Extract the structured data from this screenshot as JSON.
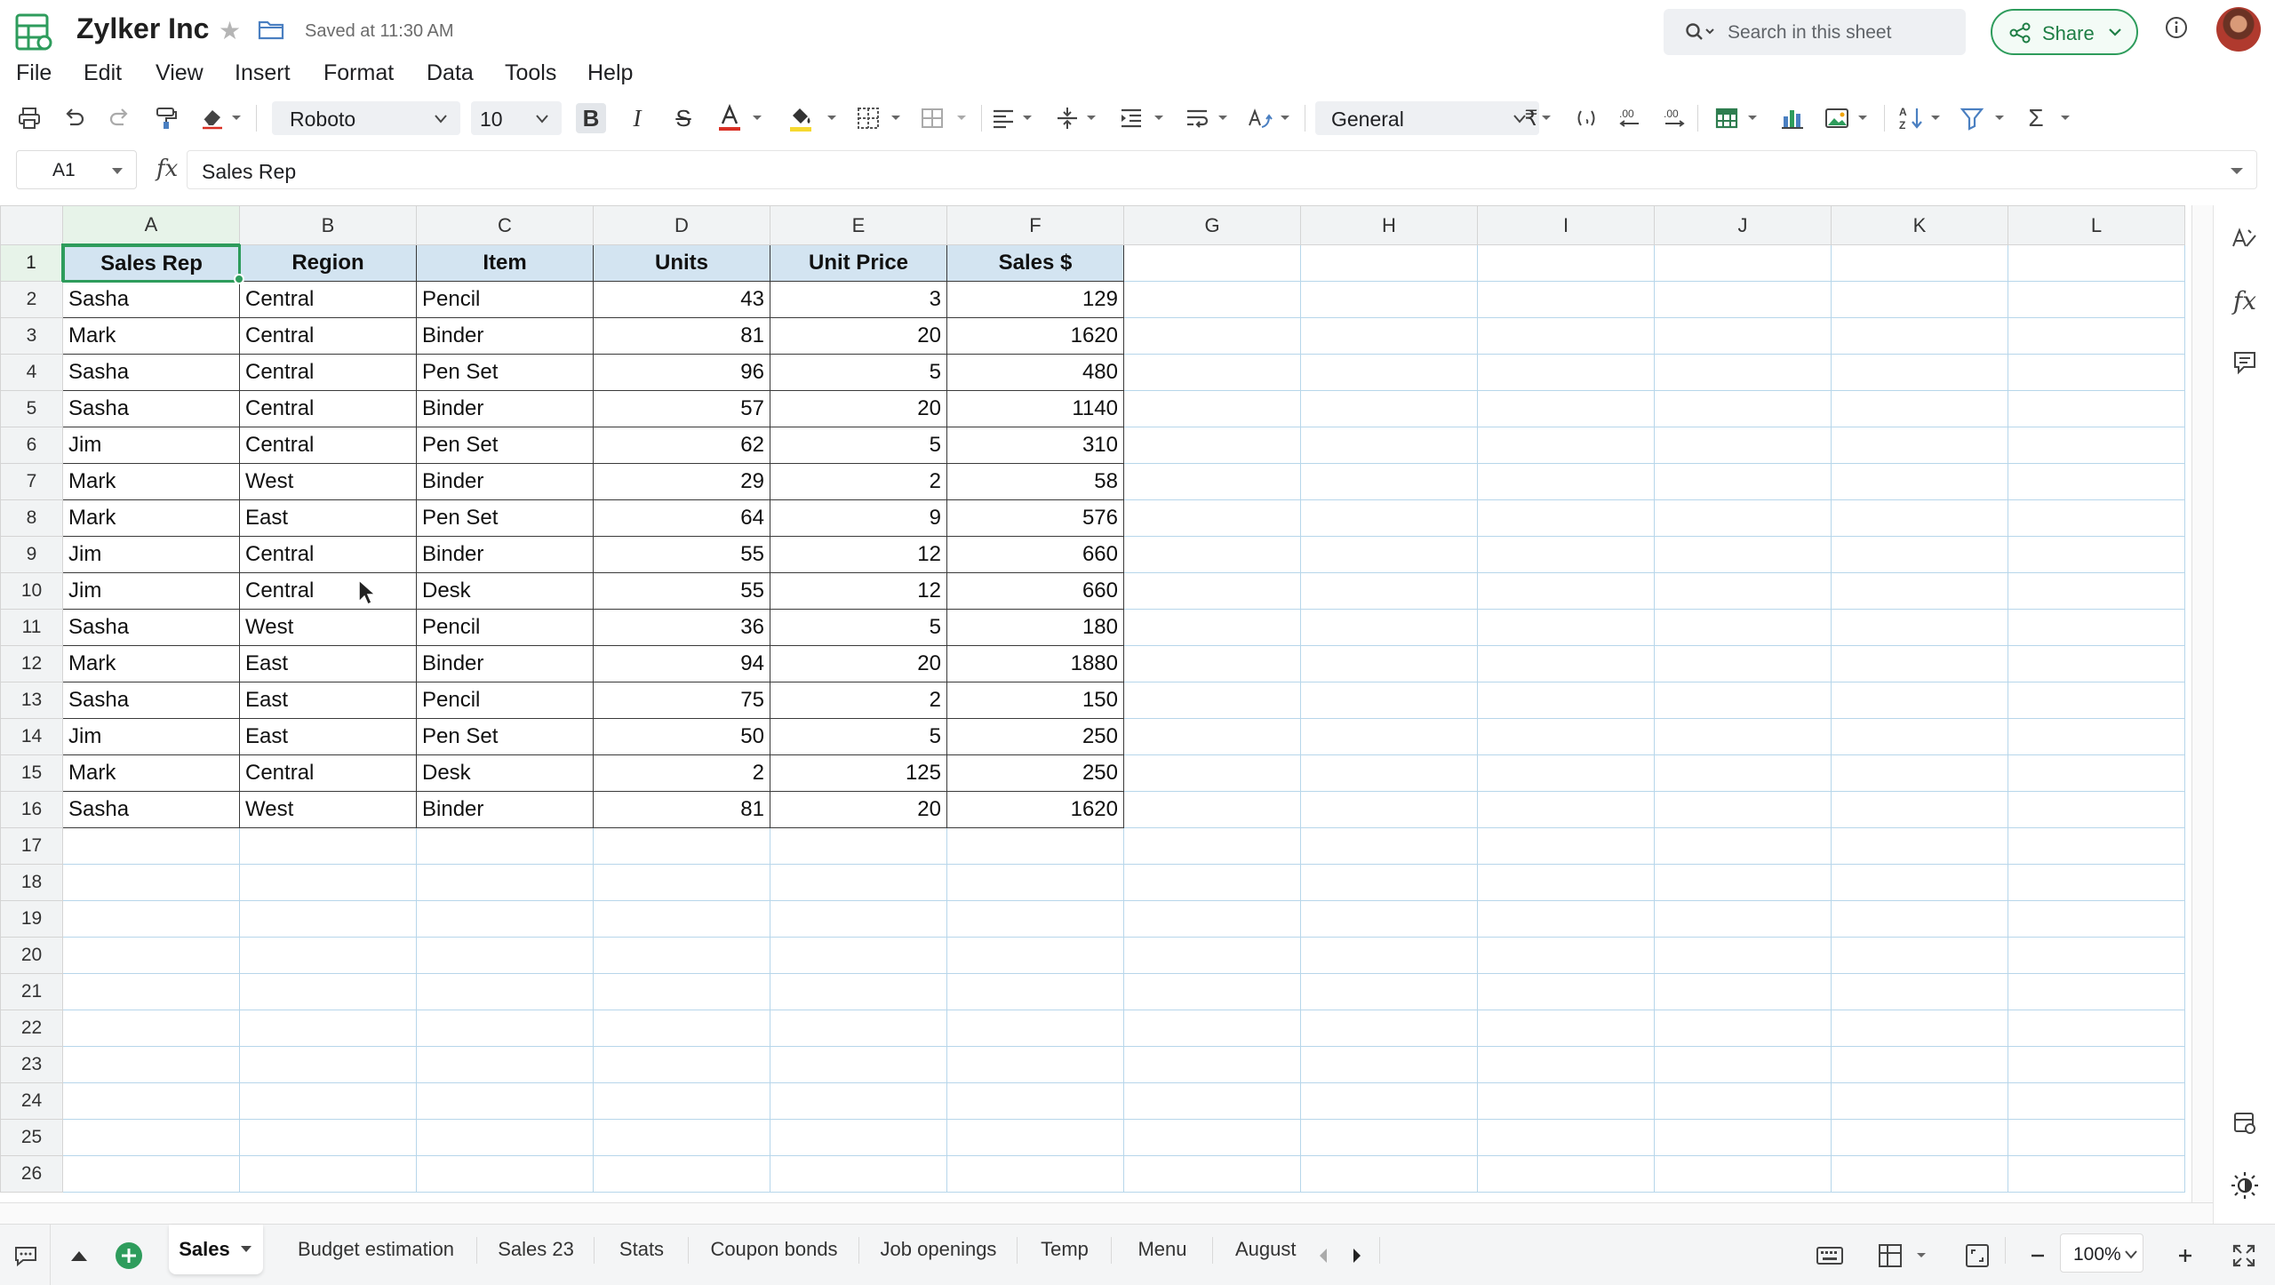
{
  "app": {
    "title": "Zylker Inc",
    "saved_status": "Saved at 11:30 AM",
    "search_placeholder": "Search in this sheet",
    "share_label": "Share"
  },
  "menu": [
    "File",
    "Edit",
    "View",
    "Insert",
    "Format",
    "Data",
    "Tools",
    "Help"
  ],
  "toolbar": {
    "font_name": "Roboto",
    "font_size": "10",
    "number_format": "General",
    "currency_symbol": "₹",
    "text_color": "#d93025",
    "fill_color": "#f6d930"
  },
  "formula_bar": {
    "cell_ref": "A1",
    "fx_label": "fx",
    "content": "Sales Rep"
  },
  "sheet": {
    "columns": [
      "A",
      "B",
      "C",
      "D",
      "E",
      "F",
      "G",
      "H",
      "I",
      "J",
      "K",
      "L"
    ],
    "row_count_visible": 26,
    "header": [
      "Sales Rep",
      "Region",
      "Item",
      "Units",
      "Unit Price",
      "Sales $"
    ],
    "rows": [
      [
        "Sasha",
        "Central",
        "Pencil",
        "43",
        "3",
        "129"
      ],
      [
        "Mark",
        "Central",
        "Binder",
        "81",
        "20",
        "1620"
      ],
      [
        "Sasha",
        "Central",
        "Pen Set",
        "96",
        "5",
        "480"
      ],
      [
        "Sasha",
        "Central",
        "Binder",
        "57",
        "20",
        "1140"
      ],
      [
        "Jim",
        "Central",
        "Pen Set",
        "62",
        "5",
        "310"
      ],
      [
        "Mark",
        "West",
        "Binder",
        "29",
        "2",
        "58"
      ],
      [
        "Mark",
        "East",
        "Pen Set",
        "64",
        "9",
        "576"
      ],
      [
        "Jim",
        "Central",
        "Binder",
        "55",
        "12",
        "660"
      ],
      [
        "Jim",
        "Central",
        "Desk",
        "55",
        "12",
        "660"
      ],
      [
        "Sasha",
        "West",
        "Pencil",
        "36",
        "5",
        "180"
      ],
      [
        "Mark",
        "East",
        "Binder",
        "94",
        "20",
        "1880"
      ],
      [
        "Sasha",
        "East",
        "Pencil",
        "75",
        "2",
        "150"
      ],
      [
        "Jim",
        "East",
        "Pen Set",
        "50",
        "5",
        "250"
      ],
      [
        "Mark",
        "Central",
        "Desk",
        "2",
        "125",
        "250"
      ],
      [
        "Sasha",
        "West",
        "Binder",
        "81",
        "20",
        "1620"
      ]
    ],
    "active_cell": "A1",
    "header_fill": "#d3e4f1",
    "selection_color": "#2e9c5c"
  },
  "tabs": {
    "items": [
      "Sales",
      "Budget estimation",
      "Sales 23",
      "Stats",
      "Coupon bonds",
      "Job openings",
      "Temp",
      "Menu",
      "August"
    ],
    "active": "Sales",
    "zoom": "100%"
  },
  "icons": {
    "title": [
      "sheet-logo-icon",
      "star-icon",
      "folder-icon",
      "search-icon",
      "share-icon",
      "info-icon"
    ],
    "side": [
      "text-style-icon",
      "function-icon",
      "comment-icon",
      "sheet-settings-icon",
      "theme-icon"
    ]
  }
}
